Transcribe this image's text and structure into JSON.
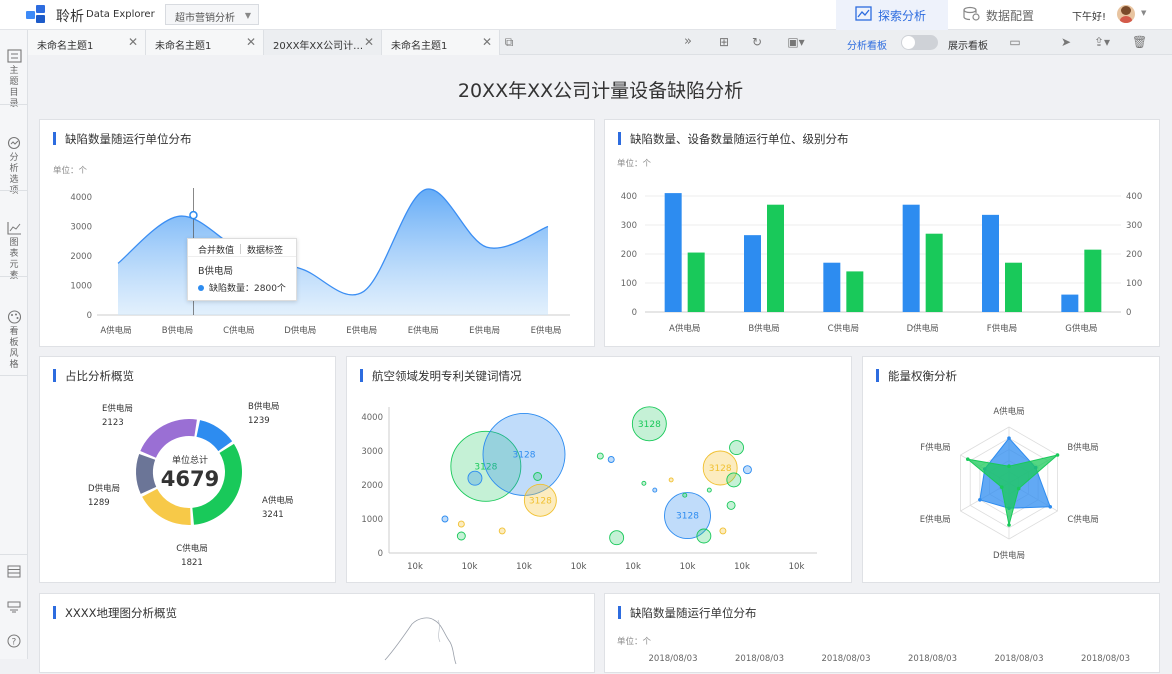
{
  "app": {
    "brand": "聆析",
    "brand_sub": "Data Explorer",
    "project": "超市营销分析"
  },
  "modes": [
    {
      "label": "探索分析",
      "active": true
    },
    {
      "label": "数据配置",
      "active": false
    }
  ],
  "user": {
    "greeting": "下午好!"
  },
  "tabs": [
    {
      "label": "未命名主题1"
    },
    {
      "label": "未命名主题1"
    },
    {
      "label": "20XX年XX公司计…"
    },
    {
      "label": "未命名主题1"
    }
  ],
  "toolbar": {
    "analysis_board": "分析看板",
    "display_board": "展示看板"
  },
  "sidebar": [
    {
      "label": "主题目录",
      "icon": "list-icon"
    },
    {
      "label": "分析选项",
      "icon": "analysis-icon"
    },
    {
      "label": "图表元素",
      "icon": "chart-icon"
    },
    {
      "label": "看板风格",
      "icon": "palette-icon"
    }
  ],
  "dashboard": {
    "title": "20XX年XX公司计量设备缺陷分析"
  },
  "colors": {
    "accent": "#2d6cdf",
    "blue": "#2d8cf0",
    "green": "#19c95a",
    "yellow": "#f7c948",
    "purple": "#9a6fd4",
    "slate": "#6b7597"
  },
  "cards": {
    "area": {
      "title": "缺陷数量随运行单位分布",
      "unit": "单位：个",
      "tooltip": {
        "merge": "合并数值",
        "labels": "数据标签",
        "name": "B供电局",
        "series": "缺陷数量",
        "value": "2800个"
      }
    },
    "bar": {
      "title": "缺陷数量、设备数量随运行单位、级别分布",
      "unit": "单位：个"
    },
    "donut": {
      "title": "占比分析概览",
      "center_label": "单位总计",
      "center_value": "4679"
    },
    "bubble": {
      "title": "航空领域发明专利关键词情况"
    },
    "radar": {
      "title": "能量权衡分析"
    },
    "map": {
      "title": "XXXX地理图分析概览"
    },
    "bar2": {
      "title": "缺陷数量随运行单位分布",
      "unit": "单位：个"
    }
  },
  "chart_data": [
    {
      "type": "area",
      "categories": [
        "A供电局",
        "B供电局",
        "C供电局",
        "D供电局",
        "E供电局",
        "E供电局",
        "E供电局",
        "E供电局"
      ],
      "values": [
        1750,
        3350,
        2200,
        1550,
        800,
        4250,
        2300,
        3000
      ],
      "ylim": [
        0,
        4000
      ],
      "yticks": [
        0,
        1000,
        2000,
        3000,
        4000
      ],
      "title": "缺陷数量随运行单位分布"
    },
    {
      "type": "bar",
      "categories": [
        "A供电局",
        "B供电局",
        "C供电局",
        "D供电局",
        "F供电局",
        "G供电局"
      ],
      "series": [
        {
          "values": [
            410,
            265,
            170,
            370,
            335,
            60
          ]
        },
        {
          "values": [
            205,
            370,
            140,
            270,
            170,
            215
          ]
        }
      ],
      "ylim": [
        0,
        400
      ],
      "yticks": [
        0,
        100,
        200,
        300,
        400
      ],
      "title": "缺陷数量、设备数量随运行单位、级别分布"
    },
    {
      "type": "pie",
      "center_label": "单位总计",
      "center_value": "4679",
      "slices": [
        {
          "name": "B供电局",
          "value": 1239
        },
        {
          "name": "A供电局",
          "value": 3241
        },
        {
          "name": "C供电局",
          "value": 1821
        },
        {
          "name": "D供电局",
          "value": 1289
        },
        {
          "name": "E供电局",
          "value": 2123
        }
      ],
      "title": "占比分析概览"
    },
    {
      "type": "scatter",
      "xticks": [
        "10k",
        "10k",
        "10k",
        "10k",
        "10k",
        "10k",
        "10k",
        "10k"
      ],
      "ylim": [
        0,
        4000
      ],
      "yticks": [
        0,
        1000,
        2000,
        3000,
        4000
      ],
      "bubbles": [
        {
          "x": 1.3,
          "y": 2550,
          "r": 35,
          "color": "green",
          "label": "3128"
        },
        {
          "x": 2.0,
          "y": 2900,
          "r": 41,
          "color": "blue",
          "label": "3128"
        },
        {
          "x": 2.3,
          "y": 1550,
          "r": 16,
          "color": "yellow",
          "label": "3128"
        },
        {
          "x": 4.3,
          "y": 3800,
          "r": 17,
          "color": "green",
          "label": "3128"
        },
        {
          "x": 5.6,
          "y": 2500,
          "r": 17,
          "color": "yellow",
          "label": "3128"
        },
        {
          "x": 5.0,
          "y": 1100,
          "r": 23,
          "color": "blue",
          "label": "3128"
        },
        {
          "x": 1.1,
          "y": 2200,
          "r": 7,
          "color": "blue",
          "label": ""
        },
        {
          "x": 2.25,
          "y": 2250,
          "r": 4,
          "color": "green",
          "label": ""
        },
        {
          "x": 0.55,
          "y": 1000,
          "r": 3,
          "color": "blue",
          "label": ""
        },
        {
          "x": 0.85,
          "y": 850,
          "r": 3,
          "color": "yellow",
          "label": ""
        },
        {
          "x": 0.85,
          "y": 500,
          "r": 4,
          "color": "green",
          "label": ""
        },
        {
          "x": 1.6,
          "y": 650,
          "r": 3,
          "color": "yellow",
          "label": ""
        },
        {
          "x": 3.7,
          "y": 450,
          "r": 7,
          "color": "green",
          "label": ""
        },
        {
          "x": 3.4,
          "y": 2850,
          "r": 3,
          "color": "green",
          "label": ""
        },
        {
          "x": 3.6,
          "y": 2750,
          "r": 3,
          "color": "blue",
          "label": ""
        },
        {
          "x": 4.2,
          "y": 2050,
          "r": 2,
          "color": "green",
          "label": ""
        },
        {
          "x": 4.4,
          "y": 1850,
          "r": 2,
          "color": "blue",
          "label": ""
        },
        {
          "x": 4.7,
          "y": 2150,
          "r": 2,
          "color": "yellow",
          "label": ""
        },
        {
          "x": 4.95,
          "y": 1700,
          "r": 2,
          "color": "green",
          "label": ""
        },
        {
          "x": 5.3,
          "y": 500,
          "r": 7,
          "color": "green",
          "label": ""
        },
        {
          "x": 5.65,
          "y": 650,
          "r": 3,
          "color": "yellow",
          "label": ""
        },
        {
          "x": 5.9,
          "y": 3100,
          "r": 7,
          "color": "green",
          "label": ""
        },
        {
          "x": 5.85,
          "y": 2150,
          "r": 7,
          "color": "green",
          "label": ""
        },
        {
          "x": 6.1,
          "y": 2450,
          "r": 4,
          "color": "blue",
          "label": ""
        },
        {
          "x": 5.8,
          "y": 1400,
          "r": 4,
          "color": "green",
          "label": ""
        },
        {
          "x": 5.4,
          "y": 1850,
          "r": 2,
          "color": "green",
          "label": ""
        }
      ],
      "title": "航空领域发明专利关键词情况"
    },
    {
      "type": "radar",
      "axes": [
        "A供电局",
        "B供电局",
        "C供电局",
        "D供电局",
        "E供电局",
        "F供电局"
      ],
      "max": 100,
      "series": [
        {
          "color": "blue",
          "values": [
            80,
            55,
            85,
            45,
            60,
            50
          ]
        },
        {
          "color": "green",
          "values": [
            30,
            100,
            20,
            75,
            15,
            85
          ]
        }
      ],
      "title": "能量权衡分析"
    },
    {
      "type": "bar",
      "title": "缺陷数量随运行单位分布",
      "categories": [
        "2018/08/03",
        "2018/08/03",
        "2018/08/03",
        "2018/08/03",
        "2018/08/03",
        "2018/08/03"
      ],
      "values": []
    }
  ]
}
